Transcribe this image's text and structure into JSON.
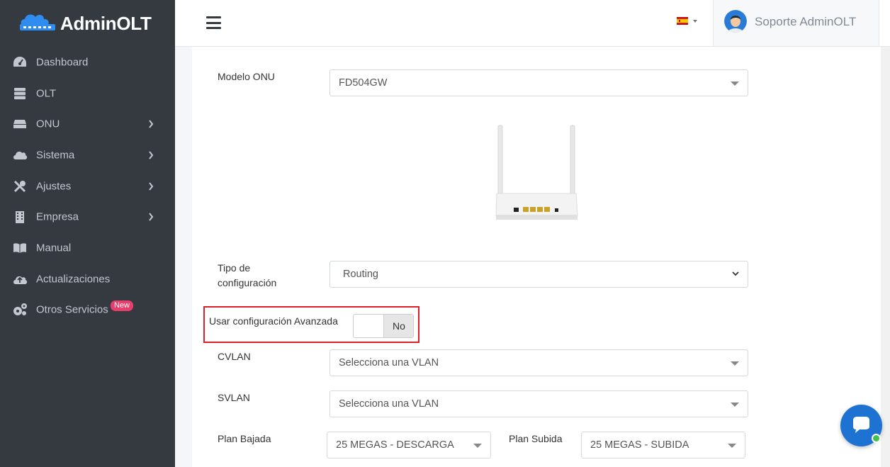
{
  "brand": {
    "name": "AdminOLT"
  },
  "sidebar": {
    "items": [
      {
        "label": "Dashboard",
        "icon": "gauge-icon",
        "has_children": false
      },
      {
        "label": "OLT",
        "icon": "server-icon",
        "has_children": false
      },
      {
        "label": "ONU",
        "icon": "hdd-icon",
        "has_children": true
      },
      {
        "label": "Sistema",
        "icon": "cloud-icon",
        "has_children": true
      },
      {
        "label": "Ajustes",
        "icon": "tools-icon",
        "has_children": true
      },
      {
        "label": "Empresa",
        "icon": "building-icon",
        "has_children": true
      },
      {
        "label": "Manual",
        "icon": "book-icon",
        "has_children": false
      },
      {
        "label": "Actualizaciones",
        "icon": "cloud-upload-icon",
        "has_children": false
      },
      {
        "label": "Otros Servicios",
        "icon": "cogs-icon",
        "has_children": false,
        "badge": "New"
      }
    ]
  },
  "header": {
    "language_flag": "es-flag-icon",
    "user_name": "Soporte AdminOLT"
  },
  "form": {
    "modelo_onu": {
      "label": "Modelo ONU",
      "value": "FD504GW"
    },
    "tipo_config": {
      "label": "Tipo de configuración",
      "value": "Routing"
    },
    "avanzada": {
      "label": "Usar configuración Avanzada",
      "toggle_value": "No"
    },
    "cvlan": {
      "label": "CVLAN",
      "placeholder": "Selecciona una VLAN"
    },
    "svlan": {
      "label": "SVLAN",
      "placeholder": "Selecciona una VLAN"
    },
    "plan_bajada": {
      "label": "Plan Bajada",
      "value": "25 MEGAS - DESCARGA"
    },
    "plan_subida": {
      "label": "Plan Subida",
      "value": "25 MEGAS - SUBIDA"
    }
  },
  "colors": {
    "sidebar_bg": "#343a40",
    "accent_blue": "#1e73d2",
    "highlight_red": "#dd1f26",
    "badge_pink": "#e83e6c",
    "online_green": "#44c053"
  }
}
